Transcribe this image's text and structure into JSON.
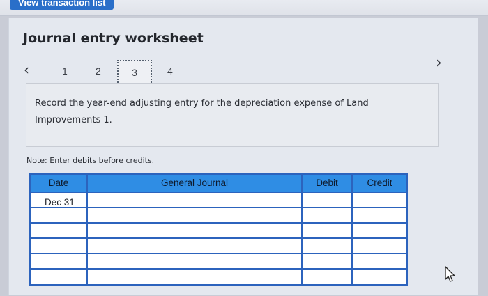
{
  "top_bar": {
    "button_label": "View transaction list"
  },
  "title": "Journal entry worksheet",
  "pager": {
    "prev_icon": "‹",
    "next_icon": "›",
    "pages": [
      "1",
      "2",
      "3",
      "4"
    ],
    "active_page": "3"
  },
  "prompt": "Record the year-end adjusting entry for the depreciation expense of Land Improvements 1.",
  "note": "Note: Enter debits before credits.",
  "table": {
    "headers": {
      "date": "Date",
      "journal": "General Journal",
      "debit": "Debit",
      "credit": "Credit"
    },
    "rows": [
      {
        "date": "Dec 31",
        "journal": "",
        "debit": "",
        "credit": ""
      },
      {
        "date": "",
        "journal": "",
        "debit": "",
        "credit": ""
      },
      {
        "date": "",
        "journal": "",
        "debit": "",
        "credit": ""
      },
      {
        "date": "",
        "journal": "",
        "debit": "",
        "credit": ""
      },
      {
        "date": "",
        "journal": "",
        "debit": "",
        "credit": ""
      },
      {
        "date": "",
        "journal": "",
        "debit": "",
        "credit": ""
      }
    ]
  },
  "colors": {
    "header_blue": "#2f8de4",
    "grid_blue": "#2c63bd",
    "button_blue": "#2a6fc9"
  }
}
